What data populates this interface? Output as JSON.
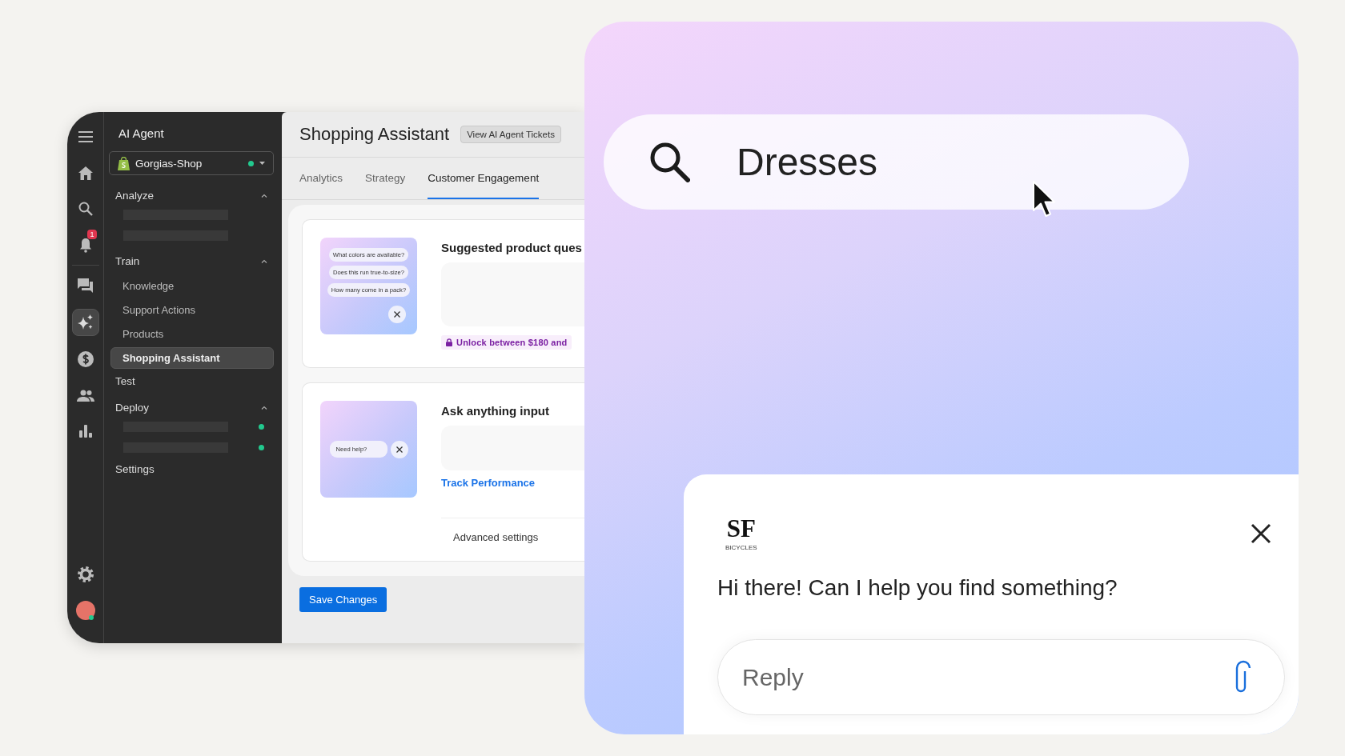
{
  "app_window": {
    "rail": [
      {
        "kind": "menu",
        "selected": false
      },
      {
        "kind": "home",
        "selected": false
      },
      {
        "kind": "search",
        "selected": false
      },
      {
        "kind": "bell",
        "selected": false,
        "badge": "1"
      },
      {
        "kind": "chat",
        "selected": false
      },
      {
        "kind": "sparkle",
        "selected": true
      },
      {
        "kind": "dollar",
        "selected": false
      },
      {
        "kind": "people",
        "selected": false
      },
      {
        "kind": "chart",
        "selected": false
      },
      {
        "kind": "gear",
        "selected": false
      },
      {
        "kind": "avatar",
        "selected": false
      }
    ],
    "sidebar": {
      "title": "AI Agent",
      "store": {
        "name": "Gorgias-Shop",
        "online": true
      },
      "sections": [
        {
          "kind": "group",
          "label": "Analyze",
          "expanded": true,
          "children": [
            {
              "kind": "skeleton",
              "live": false
            },
            {
              "kind": "skeleton",
              "live": false
            }
          ]
        },
        {
          "kind": "group",
          "label": "Train",
          "expanded": true,
          "children": [
            {
              "kind": "link",
              "label": "Knowledge",
              "selected": false
            },
            {
              "kind": "link",
              "label": "Support Actions",
              "selected": false
            },
            {
              "kind": "link",
              "label": "Products",
              "selected": false
            },
            {
              "kind": "link",
              "label": "Shopping Assistant",
              "selected": true
            }
          ]
        },
        {
          "kind": "single",
          "label": "Test"
        },
        {
          "kind": "group",
          "label": "Deploy",
          "expanded": true,
          "children": [
            {
              "kind": "skeleton",
              "live": true
            },
            {
              "kind": "skeleton",
              "live": true
            }
          ]
        },
        {
          "kind": "single",
          "label": "Settings"
        }
      ]
    },
    "main": {
      "title": "Shopping Assistant",
      "header_button": "View AI Agent Tickets",
      "tabs": [
        {
          "label": "Analytics",
          "selected": false
        },
        {
          "label": "Strategy",
          "selected": false
        },
        {
          "label": "Customer Engagement",
          "selected": true
        }
      ],
      "cards": [
        {
          "kind": "questions",
          "title": "Suggested product ques",
          "preview_chips": [
            "What colors are available?",
            "Does this run true-to-size?",
            "How many come in a pack?"
          ],
          "unlock": "Unlock between $180 and"
        },
        {
          "kind": "ask",
          "title": "Ask anything input",
          "preview_chips": [
            "Need help?"
          ],
          "link": "Track Performance",
          "footer": "Advanced settings"
        }
      ],
      "save_button": "Save Changes"
    }
  },
  "search_panel": {
    "search": {
      "value": "Dresses"
    },
    "chat": {
      "logo": {
        "mark": "SF",
        "subtitle": "BICYCLES"
      },
      "greeting": "Hi there! Can I help you find something?",
      "reply": {
        "placeholder": "Reply"
      }
    }
  }
}
